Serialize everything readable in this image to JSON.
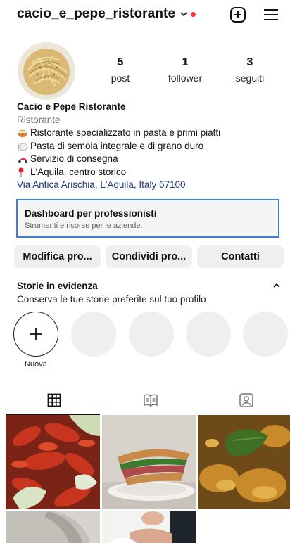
{
  "header": {
    "username": "cacio_e_pepe_ristorante",
    "icons": [
      "chevron-down-icon",
      "notification-dot",
      "plus-square-icon",
      "menu-icon"
    ],
    "notification_color": "#ff3040"
  },
  "profile": {
    "stats": [
      {
        "value": "5",
        "label": "post"
      },
      {
        "value": "1",
        "label": "follower"
      },
      {
        "value": "3",
        "label": "seguiti"
      }
    ],
    "name": "Cacio e Pepe Ristorante",
    "category": "Ristorante",
    "bio_lines": [
      {
        "icon": "pasta-emoji",
        "text": "Ristorante specializzato in pasta e primi piatti"
      },
      {
        "icon": "plate-emoji",
        "text": "Pasta di semola integrale e di grano duro"
      },
      {
        "icon": "scooter-emoji",
        "text": "Servizio di consegna"
      },
      {
        "icon": "pin-emoji",
        "text": "L'Aquila, centro storico"
      }
    ],
    "address": "Via Antica Arischia, L'Aquila, Italy 67100"
  },
  "dashboard": {
    "title": "Dashboard per professionisti",
    "subtitle": "Strumenti e risorse per le aziende.",
    "border_color": "#3f7fd6"
  },
  "actions": {
    "edit": "Modifica pro...",
    "share": "Condividi pro...",
    "contacts": "Contatti"
  },
  "highlights": {
    "title": "Storie in evidenza",
    "subtitle": "Conserva le tue storie preferite sul tuo profilo",
    "new_label": "Nuova"
  },
  "tabs": [
    "grid-icon",
    "guide-icon",
    "tagged-icon"
  ],
  "grid": [
    "crayfish-photo",
    "sandwich-photo",
    "pasta-basil-photo",
    "hand-photo",
    "chef-photo"
  ]
}
